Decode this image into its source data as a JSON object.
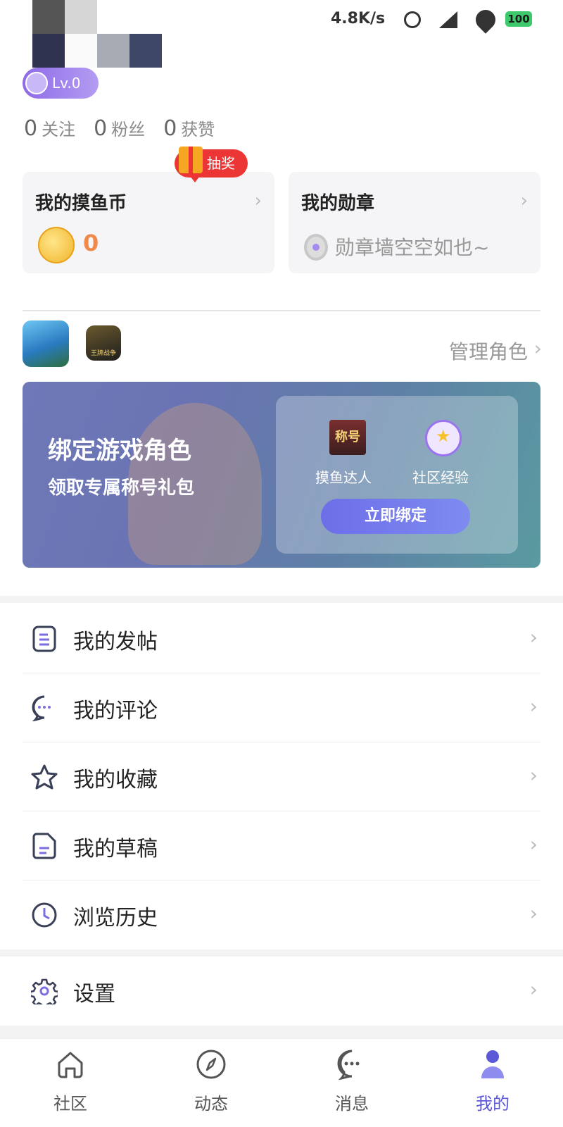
{
  "status_bar": {
    "text": "4.8K/s",
    "battery": "100"
  },
  "profile": {
    "level": "Lv.0"
  },
  "stats": [
    {
      "num": "0",
      "label": "关注"
    },
    {
      "num": "0",
      "label": "粉丝"
    },
    {
      "num": "0",
      "label": "获赞"
    }
  ],
  "lottery_badge": "抽奖",
  "coin_card": {
    "title": "我的摸鱼币",
    "value": "0"
  },
  "medal_card": {
    "title": "我的勋章",
    "empty_text": "勋章墙空空如也~"
  },
  "games": {
    "manage_label": "管理角色",
    "icons": [
      "game-icon-1",
      "game-icon-2"
    ],
    "game2_text": "王牌战争"
  },
  "banner": {
    "title": "绑定游戏角色",
    "subtitle": "领取专属称号礼包",
    "reward1_icon_text": "称号",
    "reward1_label": "摸鱼达人",
    "reward2_label": "社区经验",
    "button": "立即绑定"
  },
  "menu": [
    {
      "label": "我的发帖",
      "icon": "post-icon"
    },
    {
      "label": "我的评论",
      "icon": "comment-icon"
    },
    {
      "label": "我的收藏",
      "icon": "star-icon"
    },
    {
      "label": "我的草稿",
      "icon": "draft-icon"
    },
    {
      "label": "浏览历史",
      "icon": "clock-icon"
    }
  ],
  "settings": {
    "label": "设置",
    "icon": "gear-icon"
  },
  "tabs": [
    {
      "label": "社区",
      "icon": "home-icon",
      "active": false
    },
    {
      "label": "动态",
      "icon": "compass-icon",
      "active": false
    },
    {
      "label": "消息",
      "icon": "message-icon",
      "active": false
    },
    {
      "label": "我的",
      "icon": "user-icon",
      "active": true
    }
  ],
  "colors": {
    "accent": "#5b59d8",
    "coin": "#f08a4b",
    "lottery": "#ec3535"
  }
}
